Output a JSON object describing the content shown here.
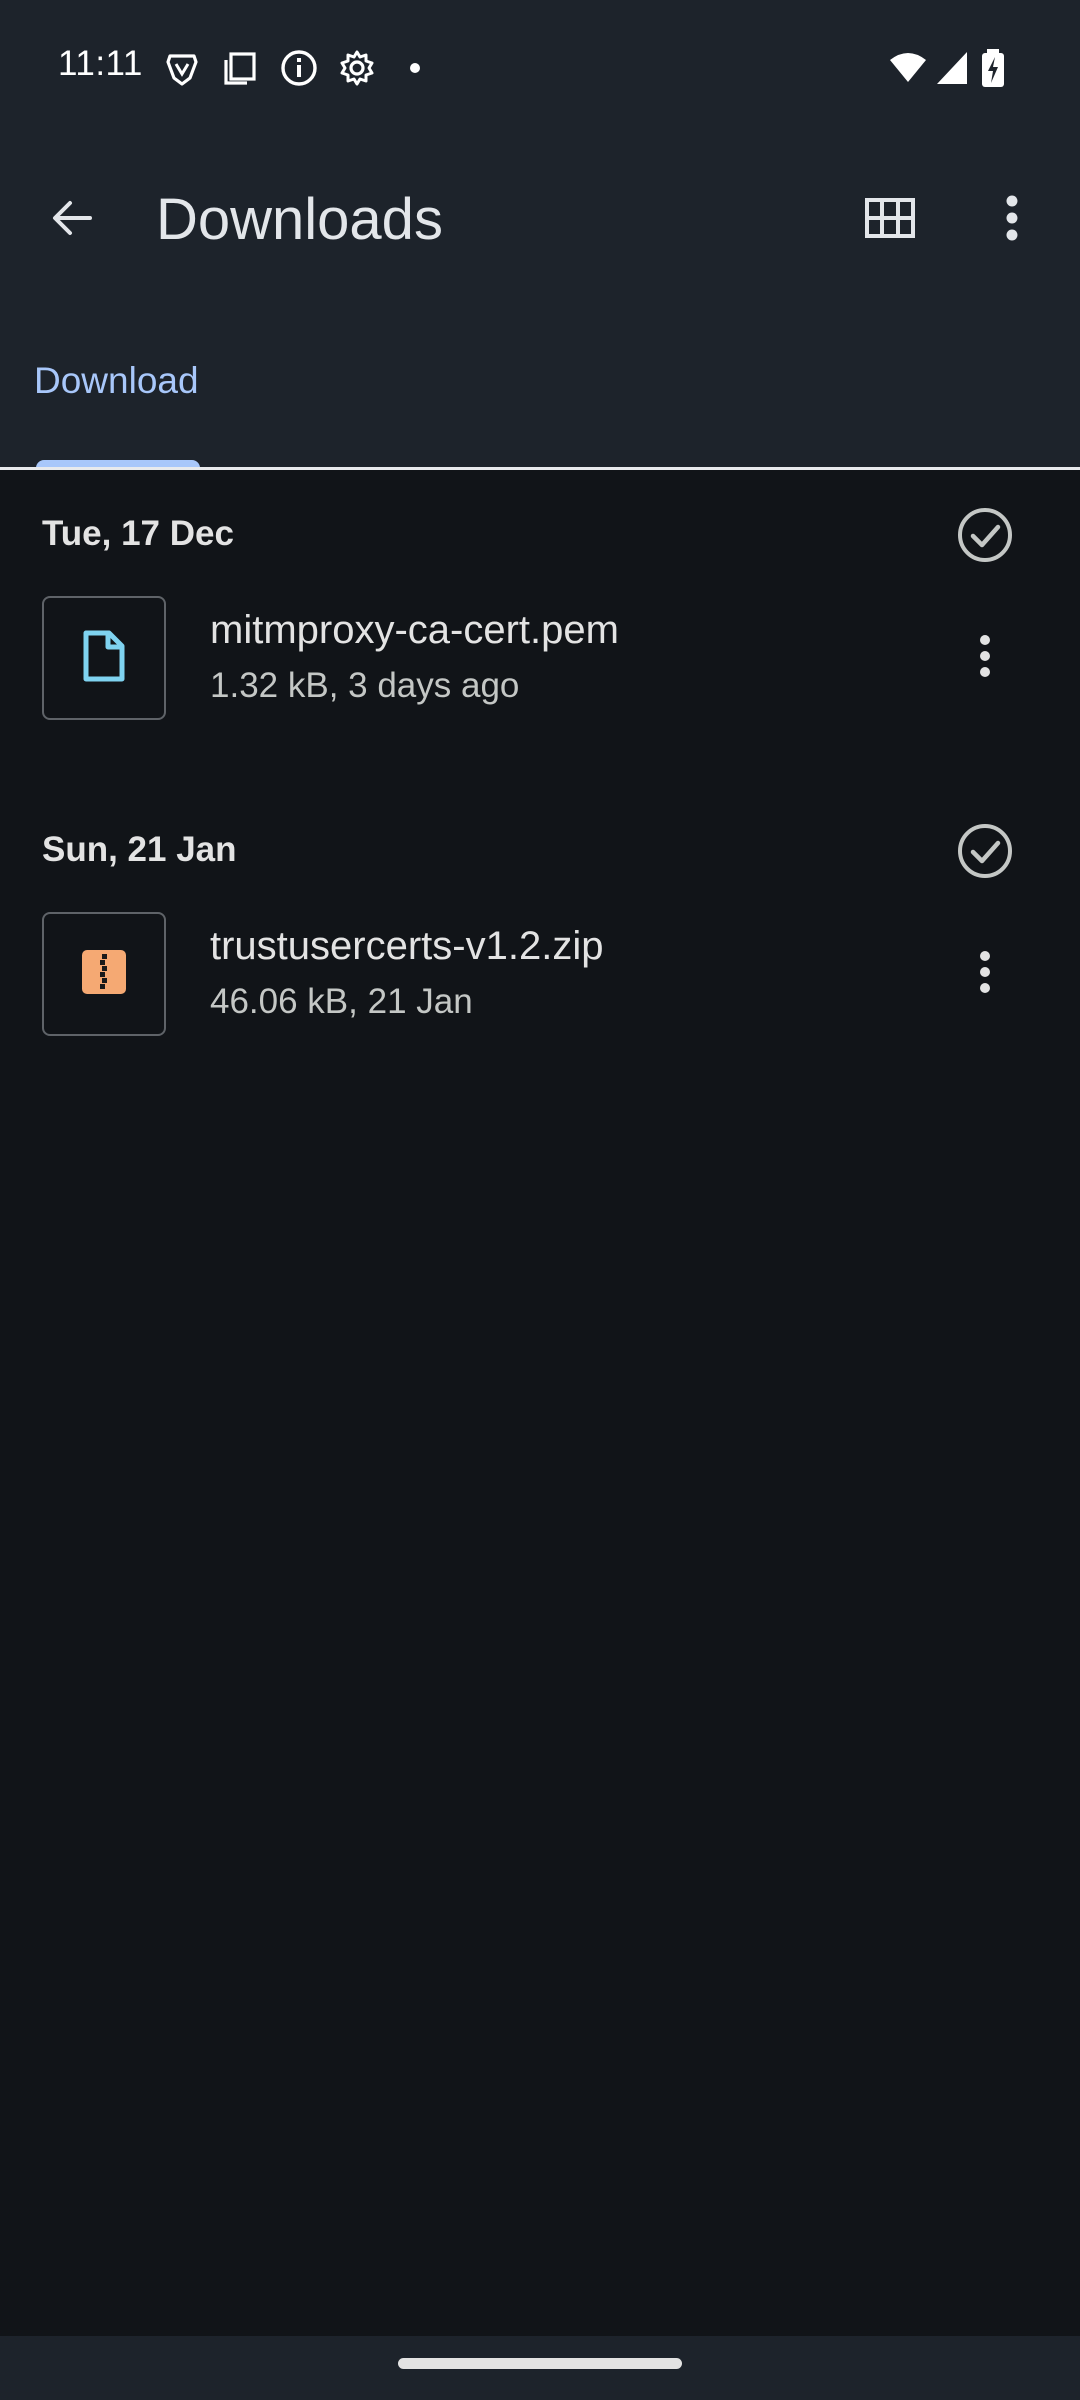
{
  "status_bar": {
    "time": "11:11",
    "left_icons": [
      "brave-icon",
      "screen-cast-icon",
      "info-icon",
      "settings-icon",
      "notification-dot-icon"
    ],
    "right_icons": [
      "wifi-icon",
      "cellular-signal-icon",
      "battery-charging-icon"
    ]
  },
  "app_bar": {
    "title": "Downloads",
    "back_icon": "arrow-back-icon",
    "grid_icon": "grid-view-icon",
    "more_icon": "more-vert-icon"
  },
  "tabs": [
    {
      "label": "Download",
      "selected": true
    }
  ],
  "sections": [
    {
      "date": "Tue, 17 Dec",
      "files": [
        {
          "name": "mitmproxy-ca-cert.pem",
          "meta": "1.32 kB, 3 days ago",
          "icon": "document-file-icon"
        }
      ]
    },
    {
      "date": "Sun, 21 Jan",
      "files": [
        {
          "name": "trustusercerts-v1.2.zip",
          "meta": "46.06 kB, 21 Jan",
          "icon": "zip-archive-icon"
        }
      ]
    }
  ],
  "colors": {
    "background": "#111418",
    "top_bar": "#1d232b",
    "accent": "#a8c7fa",
    "doc_icon": "#7fd3f0",
    "zip_icon": "#f5a973"
  }
}
